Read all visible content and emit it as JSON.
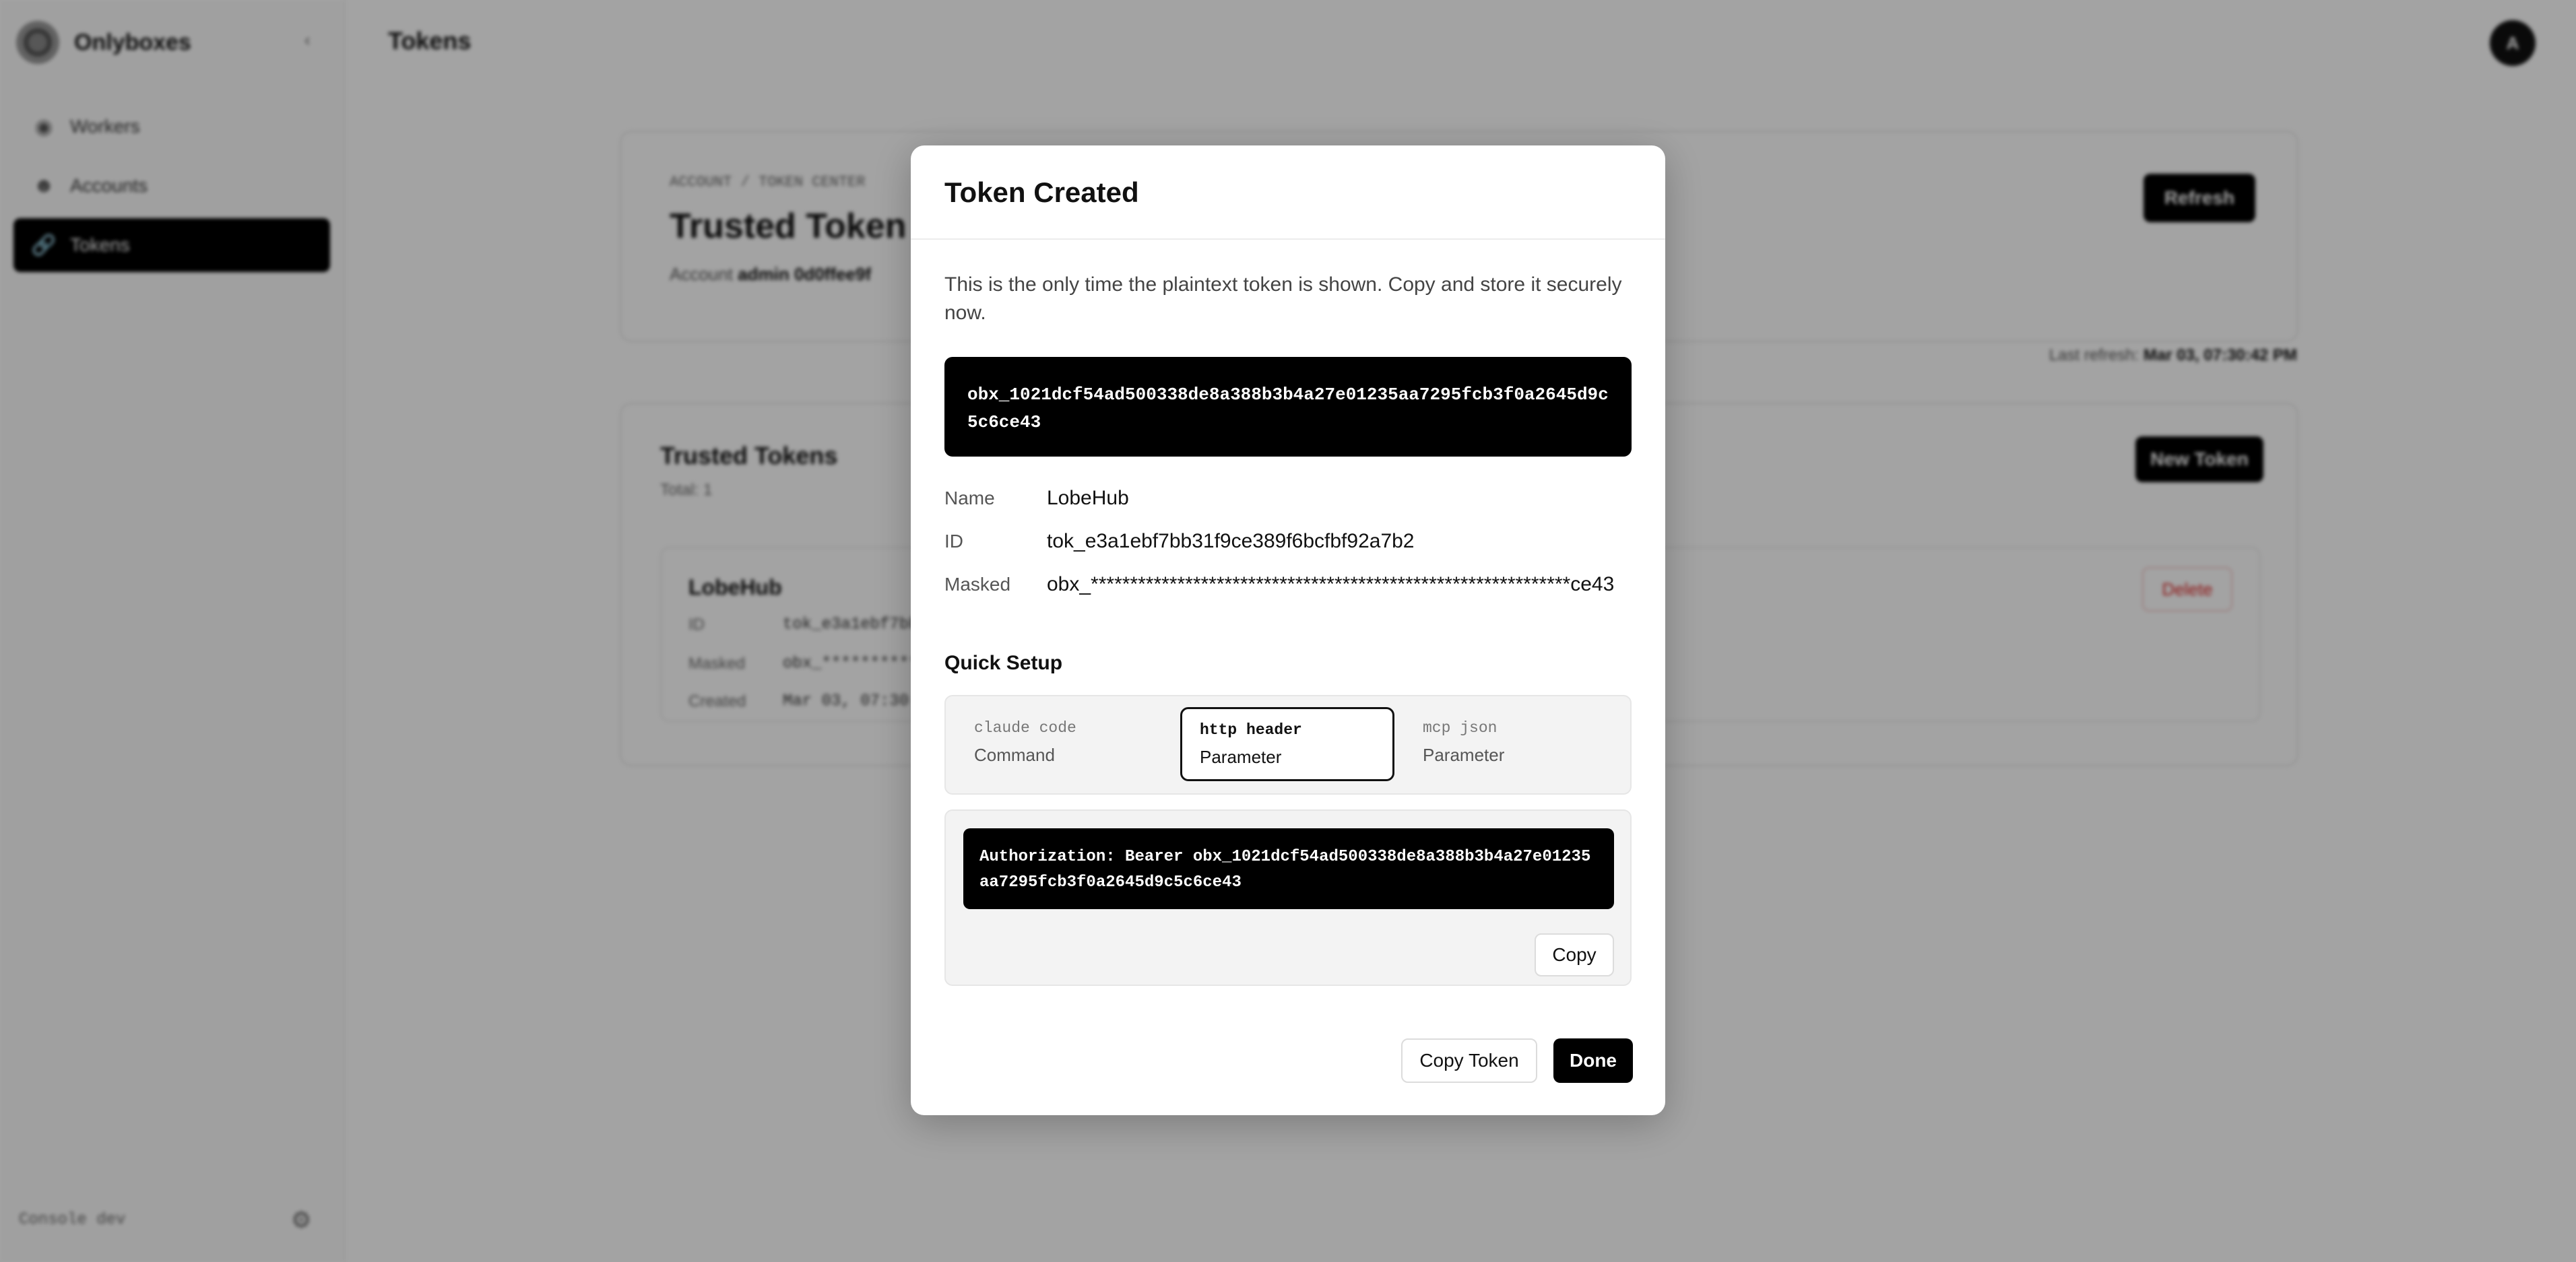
{
  "app": {
    "brand_name": "Onlyboxes",
    "page_title": "Tokens",
    "avatar_initial": "A"
  },
  "sidebar": {
    "items": [
      {
        "label": "Workers",
        "icon": "worker-icon"
      },
      {
        "label": "Accounts",
        "icon": "accounts-icon"
      },
      {
        "label": "Tokens",
        "icon": "link-icon"
      }
    ],
    "footer_label": "Console dev"
  },
  "header_card": {
    "breadcrumb": "ACCOUNT / TOKEN CENTER",
    "title": "Trusted Token Management",
    "account_label": "Account",
    "account_value": "admin 0d0ffee9f",
    "refresh_label": "Refresh",
    "last_refresh_label": "Last refresh:",
    "last_refresh_value": "Mar 03, 07:30:42 PM"
  },
  "tokens_card": {
    "title": "Trusted Tokens",
    "subtitle": "Total: 1",
    "new_token_label": "New Token",
    "row": {
      "name": "LobeHub",
      "id_label": "ID",
      "id_value": "tok_e3a1ebf7bb31f9...",
      "masked_label": "Masked",
      "masked_value": "obx_**************...",
      "created_label": "Created",
      "created_value": "Mar 03, 07:30",
      "delete_label": "Delete"
    }
  },
  "modal": {
    "title": "Token Created",
    "note": "This is the only time the plaintext token is shown. Copy and store it securely now.",
    "token": "obx_1021dcf54ad500338de8a388b3b4a27e01235aa7295fcb3f0a2645d9c5c6ce43",
    "fields": {
      "name_label": "Name",
      "name_value": "LobeHub",
      "id_label": "ID",
      "id_value": "tok_e3a1ebf7bb31f9ce389f6bcfbf92a7b2",
      "masked_label": "Masked",
      "masked_value": "obx_*************************************************************ce43"
    },
    "quick_setup_title": "Quick Setup",
    "tabs": [
      {
        "code": "claude code",
        "kind": "Command",
        "active": false
      },
      {
        "code": "http header",
        "kind": "Parameter",
        "active": true
      },
      {
        "code": "mcp json",
        "kind": "Parameter",
        "active": false
      }
    ],
    "snippet": "Authorization: Bearer obx_1021dcf54ad500338de8a388b3b4a27e01235aa7295fcb3f0a2645d9c5c6ce43",
    "copy_label": "Copy",
    "copy_token_label": "Copy Token",
    "done_label": "Done"
  }
}
